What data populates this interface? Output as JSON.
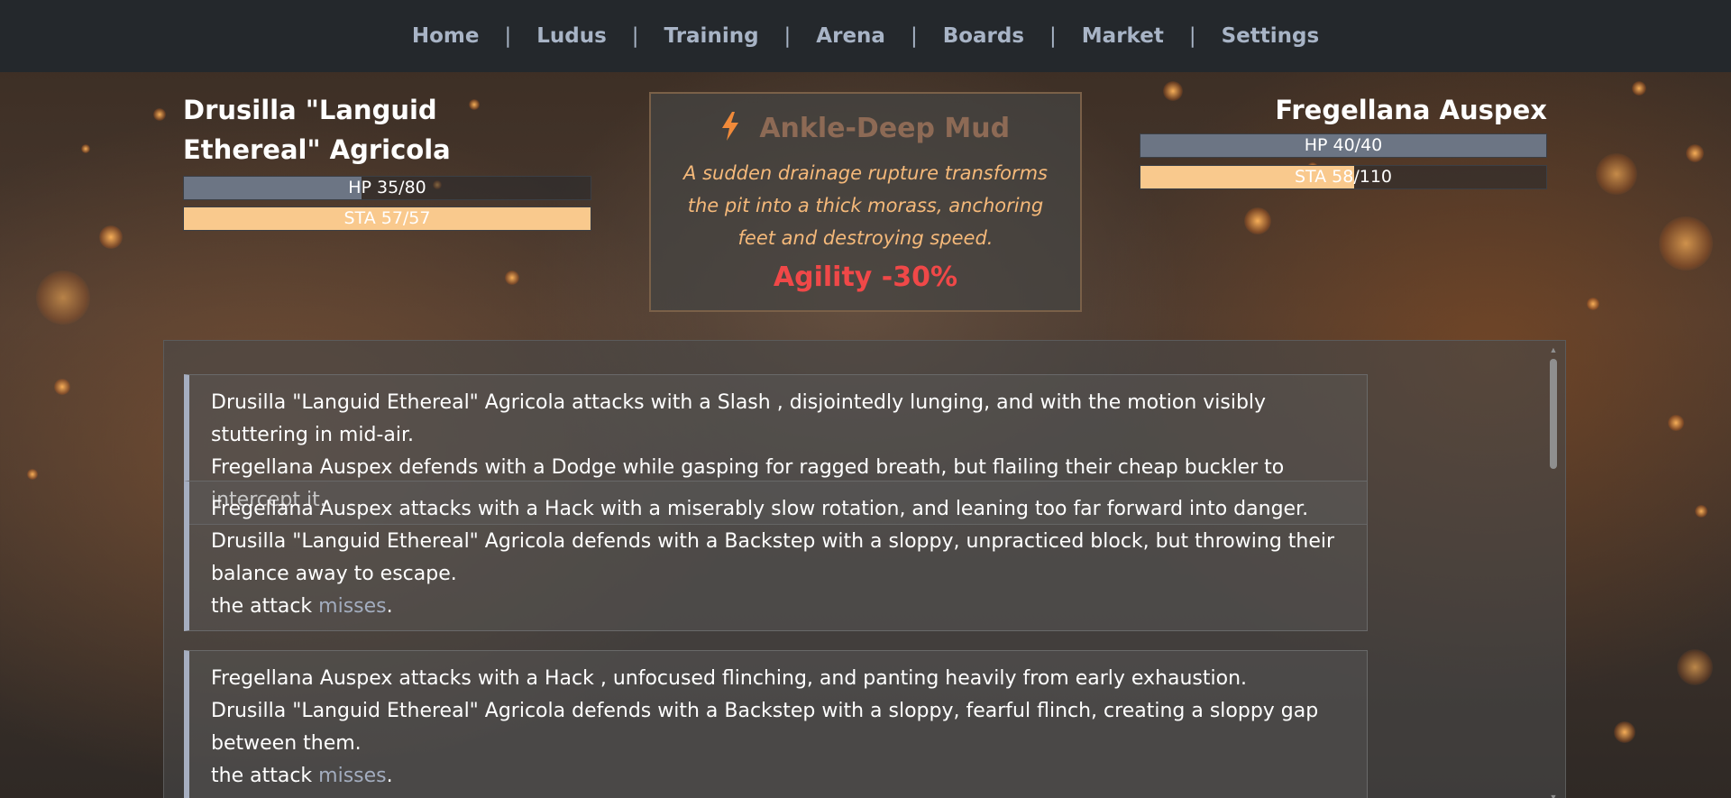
{
  "nav": {
    "items": [
      {
        "label": "Home"
      },
      {
        "label": "Ludus"
      },
      {
        "label": "Training"
      },
      {
        "label": "Arena"
      },
      {
        "label": "Boards"
      },
      {
        "label": "Market"
      },
      {
        "label": "Settings"
      }
    ],
    "separator": "|"
  },
  "fighter_left": {
    "name": "Drusilla \"Languid Ethereal\" Agricola",
    "hp_label": "HP 35/80",
    "hp_fraction": 0.4375,
    "sta_label": "STA 57/57",
    "sta_fraction": 1.0
  },
  "fighter_right": {
    "name": "Fregellana Auspex",
    "hp_label": "HP 40/40",
    "hp_fraction": 1.0,
    "sta_label": "STA 58/110",
    "sta_fraction": 0.527
  },
  "event": {
    "icon": "lightning-bolt-icon",
    "title": "Ankle-Deep Mud",
    "description": "A sudden drainage rupture transforms the pit into a thick morass, anchoring feet and destroying speed.",
    "effect": "Agility -30%"
  },
  "combat_log": [
    {
      "attack": "Drusilla \"Languid Ethereal\" Agricola attacks with a Slash , disjointedly lunging, and with the motion visibly stuttering in mid-air.",
      "defense": "Fregellana Auspex defends with a Dodge while gasping for ragged breath, but flailing their cheap buckler to intercept it.",
      "result_prefix": "",
      "result_word": "",
      "result_suffix": ""
    },
    {
      "attack": "Fregellana Auspex attacks with a Hack with a miserably slow rotation, and leaning too far forward into danger.",
      "defense": "Drusilla \"Languid Ethereal\" Agricola defends with a Backstep with a sloppy, unpracticed block, but throwing their balance away to escape.",
      "result_prefix": "the attack ",
      "result_word": "misses",
      "result_suffix": "."
    },
    {
      "attack": "Fregellana Auspex attacks with a Hack , unfocused flinching, and panting heavily from early exhaustion.",
      "defense": "Drusilla \"Languid Ethereal\" Agricola defends with a Backstep with a sloppy, fearful flinch, creating a sloppy gap between them.",
      "result_prefix": "the attack ",
      "result_word": "misses",
      "result_suffix": "."
    }
  ],
  "colors": {
    "navbar_bg": "#24282c",
    "nav_text": "#a8b4c6",
    "hp_bar": "#6c7584",
    "sta_bar": "#f9c98d",
    "event_title": "#8d6a55",
    "event_desc": "#f5b97a",
    "event_effect": "#f04848",
    "miss_text": "#a3adbf"
  }
}
